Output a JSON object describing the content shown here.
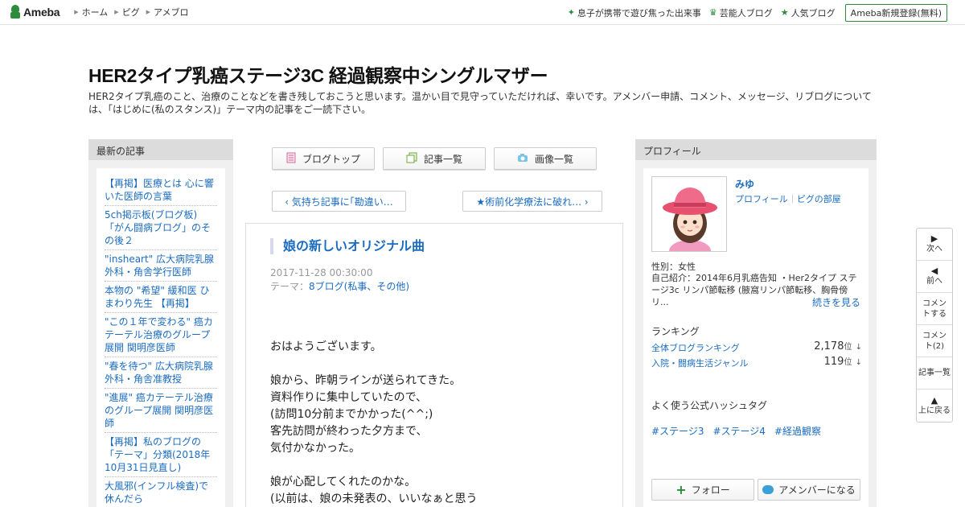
{
  "topbar": {
    "logo": "Ameba",
    "nav": [
      "ホーム",
      "ピグ",
      "アメブロ"
    ],
    "right_links": [
      {
        "icon": "sparkle-icon",
        "label": "息子が携帯で遊び焦った出来事"
      },
      {
        "icon": "crown-icon",
        "label": "芸能人ブログ"
      },
      {
        "icon": "star-icon",
        "label": "人気ブログ"
      }
    ],
    "register": "Ameba新規登録(無料)"
  },
  "header": {
    "title": "HER2タイプ乳癌ステージ3C 経過観察中シングルマザー",
    "description": "HER2タイプ乳癌のこと、治療のことなどを書き残しておこうと思います。温かい目で見守っていただければ、幸いです。アメンバー申請、コメント、メッセージ、リブログについては、「はじめに(私のスタンス)」テーマ内の記事をご一読下さい。"
  },
  "left_sidebar": {
    "heading": "最新の記事",
    "articles": [
      "【再掲】医療とは 心に響いた医師の言葉",
      "5ch掲示板(ブログ板) 「がん闘病ブログ」のその後２",
      "\"insheart\" 広大病院乳腺外科・角舎学行医師",
      "本物の \"希望\" 緩和医 ひまわり先生 【再掲】",
      "\"この１年で変わる\" 癌カテーテル治療のグループ展開 関明彦医師",
      "\"春を待つ\" 広大病院乳腺外科・角舎准教授",
      "\"進展\" 癌カテーテル治療のグループ展開 関明彦医師",
      "【再掲】私のブログの「テーマ」分類(2018年10月31日見直し)",
      "大風邪(インフル検査)で休んだら"
    ]
  },
  "center_nav": {
    "buttons": [
      {
        "icon": "document-icon",
        "label": "ブログトップ"
      },
      {
        "icon": "copy-icon",
        "label": "記事一覧"
      },
      {
        "icon": "camera-icon",
        "label": "画像一覧"
      }
    ],
    "prev": "‹ 気持ち記事に｢勘違い…",
    "next": "★術前化学療法に破れ… ›"
  },
  "article": {
    "title": "娘の新しいオリジナル曲",
    "date": "2017-11-28 00:30:00",
    "theme_label": "テーマ：",
    "theme": "8ブログ(私事、その他)",
    "paragraphs": [
      [
        "おはようございます。"
      ],
      [
        "娘から、昨朝ラインが送られてきた。",
        "資料作りに集中していたので、",
        "(訪問10分前までかかった(^^;)",
        "客先訪問が終わった夕方まで、",
        "気付かなかった。"
      ],
      [
        "娘が心配してくれたのかな。",
        "(以前は、娘の未発表の、いいなぁと思う"
      ]
    ]
  },
  "profile": {
    "heading": "プロフィール",
    "name": "みゆ",
    "link1": "プロフィール",
    "sep": "｜",
    "link2": "ピグの部屋",
    "gender": "性別：女性",
    "intro": "自己紹介：2014年6月乳癌告知 ・Her2タイプ ステージ3c リンパ節転移 (腋窩リンパ節転移、胸骨傍リ...",
    "more": "続きを見る",
    "ranking_heading": "ランキング",
    "rankings": [
      {
        "label": "全体ブログランキング",
        "value": "2,178",
        "unit": "位",
        "trend": "↓"
      },
      {
        "label": "入院・闘病生活ジャンル",
        "value": "119",
        "unit": "位",
        "trend": "↓"
      }
    ],
    "hashtag_heading": "よく使う公式ハッシュタグ",
    "hashtags": [
      "#ステージ3",
      "#ステージ4",
      "#経過観察"
    ],
    "follow": "フォロー",
    "amember": "アメンバーになる"
  },
  "float_nav": [
    {
      "icon": "triangle-right-icon",
      "label": "次へ"
    },
    {
      "icon": "triangle-left-icon",
      "label": "前へ"
    },
    {
      "icon": "",
      "label": "コメントする"
    },
    {
      "icon": "",
      "label": "コメント(2)"
    },
    {
      "icon": "",
      "label": "記事一覧"
    },
    {
      "icon": "triangle-up-icon",
      "label": "上に戻る"
    }
  ],
  "colors": {
    "brand_green": "#2d8c3c",
    "link_blue": "#1a6cc0",
    "sidebar_bg": "#f0f0f0",
    "sidebar_header": "#dcdcdc"
  }
}
